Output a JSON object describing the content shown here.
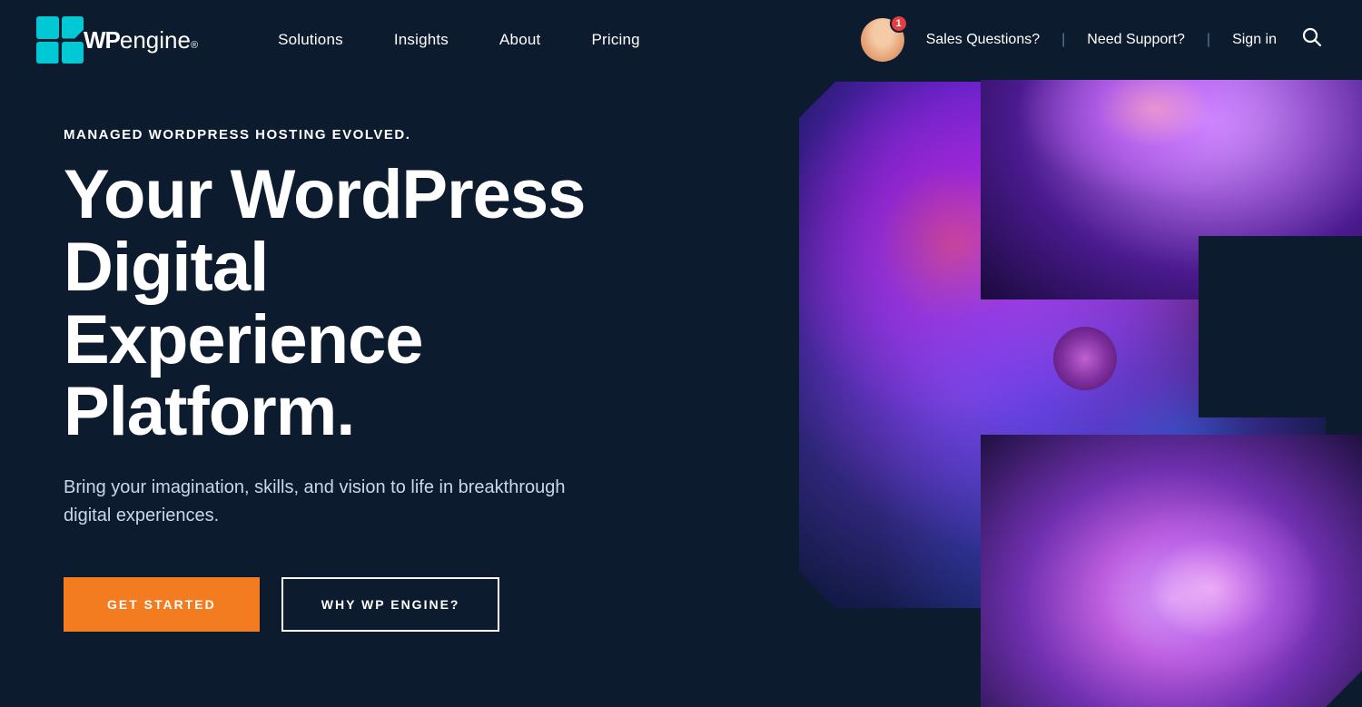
{
  "navbar": {
    "logo": {
      "wp": "WP",
      "engine": "engine",
      "reg": "®"
    },
    "nav_links": [
      {
        "label": "Solutions",
        "id": "solutions"
      },
      {
        "label": "Insights",
        "id": "insights"
      },
      {
        "label": "About",
        "id": "about"
      },
      {
        "label": "Pricing",
        "id": "pricing"
      }
    ],
    "right": {
      "notification_count": "1",
      "sales": "Sales Questions?",
      "support": "Need Support?",
      "signin": "Sign in",
      "search_aria": "Search"
    }
  },
  "hero": {
    "subtitle": "MANAGED WORDPRESS HOSTING EVOLVED.",
    "title_line1": "Your WordPress Digital",
    "title_line2": "Experience Platform.",
    "description": "Bring your imagination, skills, and vision to life in breakthrough digital experiences.",
    "cta_primary": "GET STARTED",
    "cta_secondary": "WHY WP ENGINE?"
  },
  "colors": {
    "navbar_bg": "#0d1b2e",
    "hero_bg": "#0d1b2e",
    "accent_orange": "#f47c20",
    "accent_teal": "#00c8d4"
  }
}
